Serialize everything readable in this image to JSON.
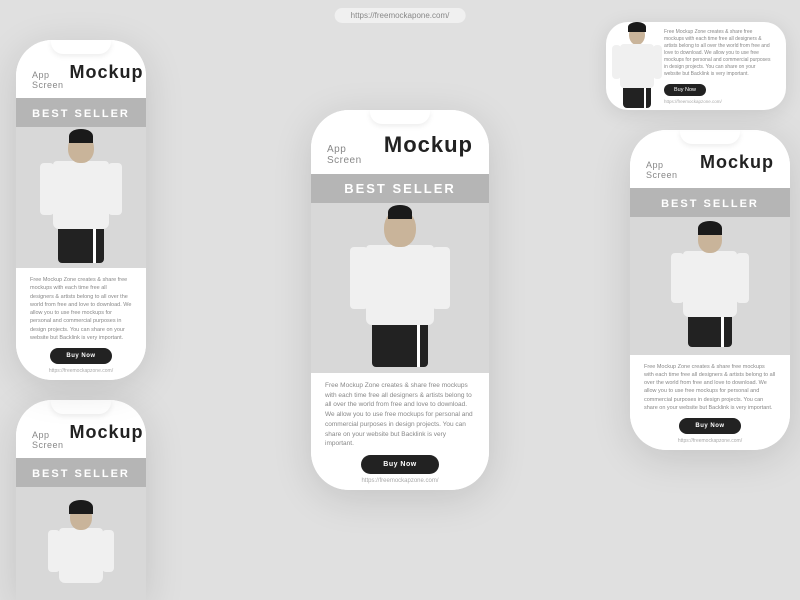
{
  "url": "https://freemockapone.com/",
  "phones": {
    "header": {
      "app_label": "App Screen",
      "mockup_label": "Mockup"
    },
    "banner": {
      "text": "Best Seller"
    },
    "content": {
      "description": "Free Mockup Zone creates & share free mockups with each time free all designers & artists belong to all over the world from free and love to download. We allow you to use free mockups for personal and commercial purposes in design projects. You can share on your website but Backlink is very important.",
      "buy_button": "Buy Now",
      "url": "https://freemockapzone.com/"
    }
  }
}
